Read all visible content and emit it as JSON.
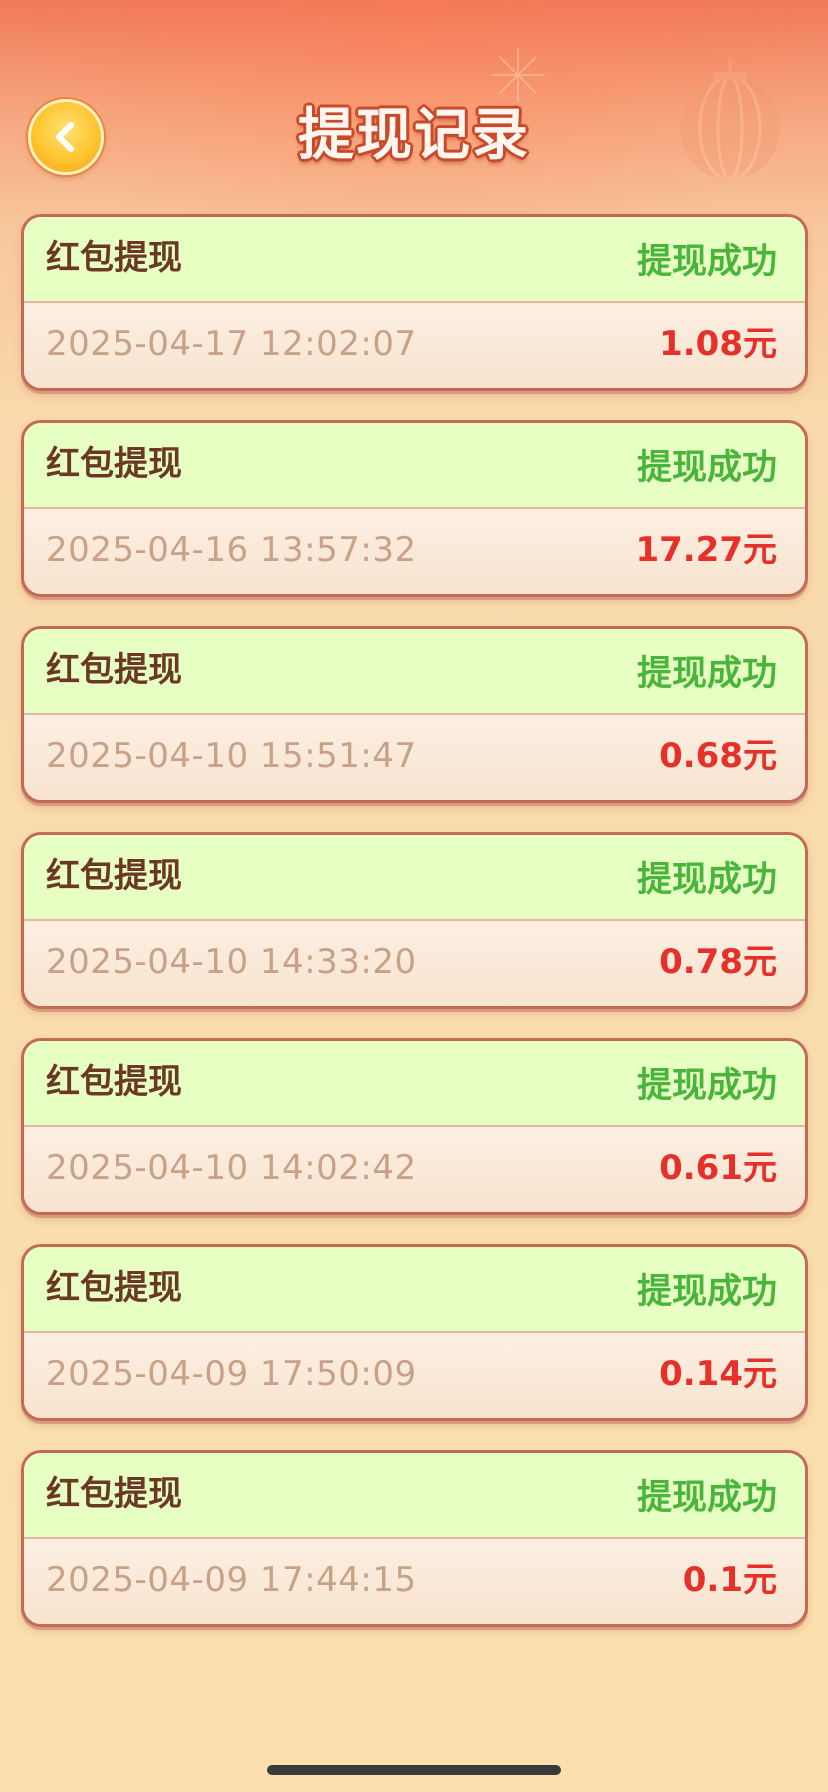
{
  "header": {
    "title": "提现记录",
    "back_icon": "chevron-left-icon"
  },
  "colors": {
    "status_success": "#49b53a",
    "amount": "#e6302a",
    "card_border": "#c26a55",
    "card_top_bg": "#e7ffc3",
    "back_button": "#ffc530"
  },
  "records": [
    {
      "type": "红包提现",
      "status": "提现成功",
      "time": "2025-04-17 12:02:07",
      "amount": "1.08元"
    },
    {
      "type": "红包提现",
      "status": "提现成功",
      "time": "2025-04-16 13:57:32",
      "amount": "17.27元"
    },
    {
      "type": "红包提现",
      "status": "提现成功",
      "time": "2025-04-10 15:51:47",
      "amount": "0.68元"
    },
    {
      "type": "红包提现",
      "status": "提现成功",
      "time": "2025-04-10 14:33:20",
      "amount": "0.78元"
    },
    {
      "type": "红包提现",
      "status": "提现成功",
      "time": "2025-04-10 14:02:42",
      "amount": "0.61元"
    },
    {
      "type": "红包提现",
      "status": "提现成功",
      "time": "2025-04-09 17:50:09",
      "amount": "0.14元"
    },
    {
      "type": "红包提现",
      "status": "提现成功",
      "time": "2025-04-09 17:44:15",
      "amount": "0.1元"
    }
  ]
}
